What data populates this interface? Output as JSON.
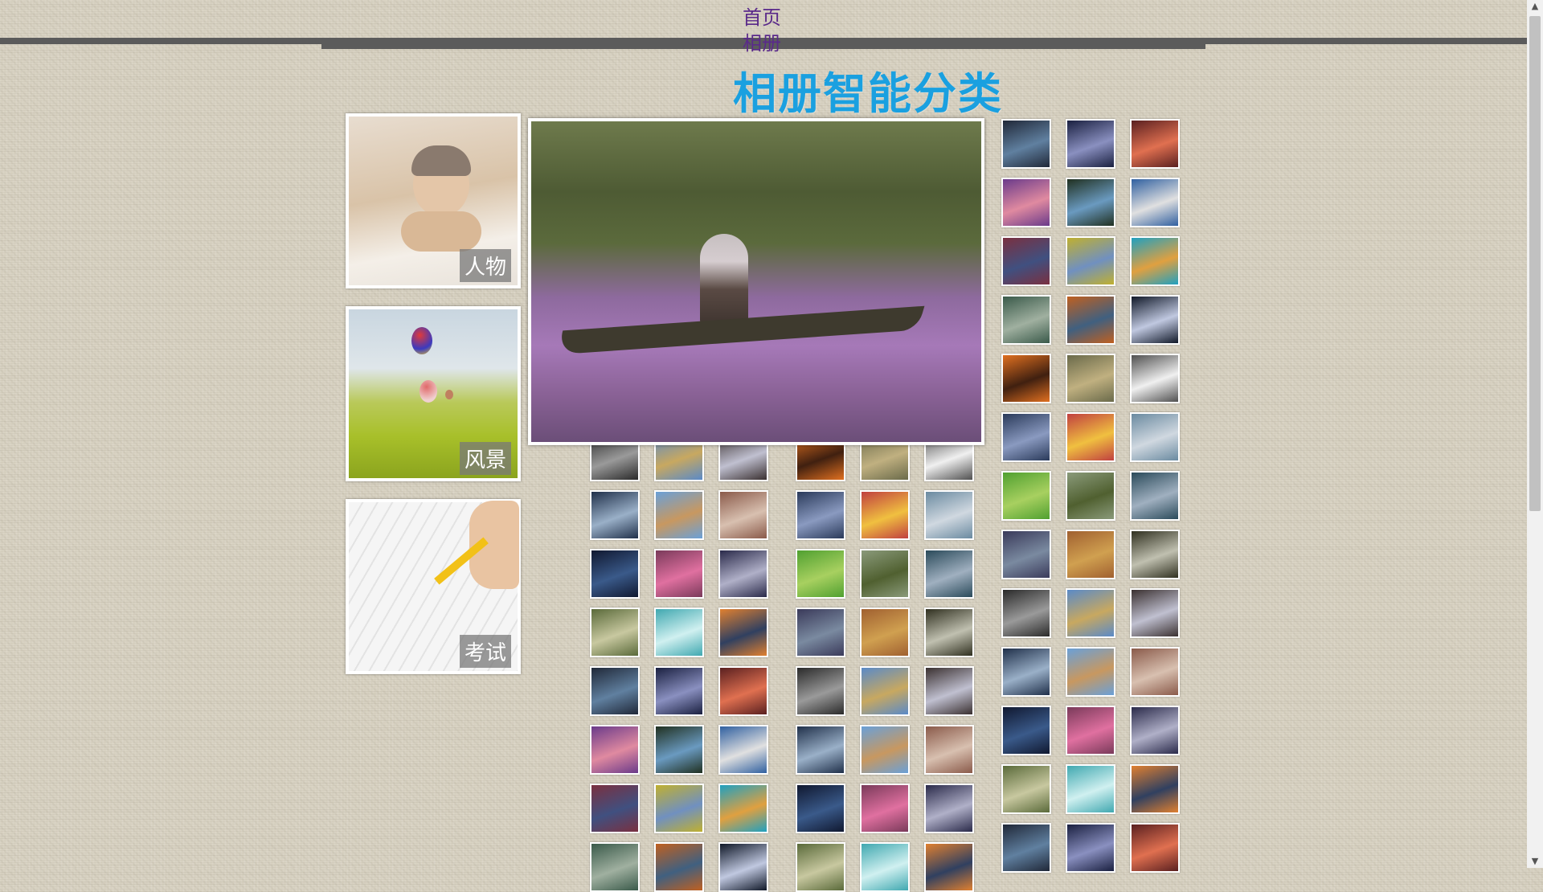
{
  "nav": {
    "home": "首页",
    "album": "相册"
  },
  "page": {
    "title": "相册智能分类"
  },
  "categories": [
    {
      "label": "人物"
    },
    {
      "label": "风景"
    },
    {
      "label": "考试"
    }
  ],
  "colors": {
    "title": "#1aa0e0",
    "nav_link": "#5a2a8a",
    "nav_bar": "#5b5b5b"
  }
}
